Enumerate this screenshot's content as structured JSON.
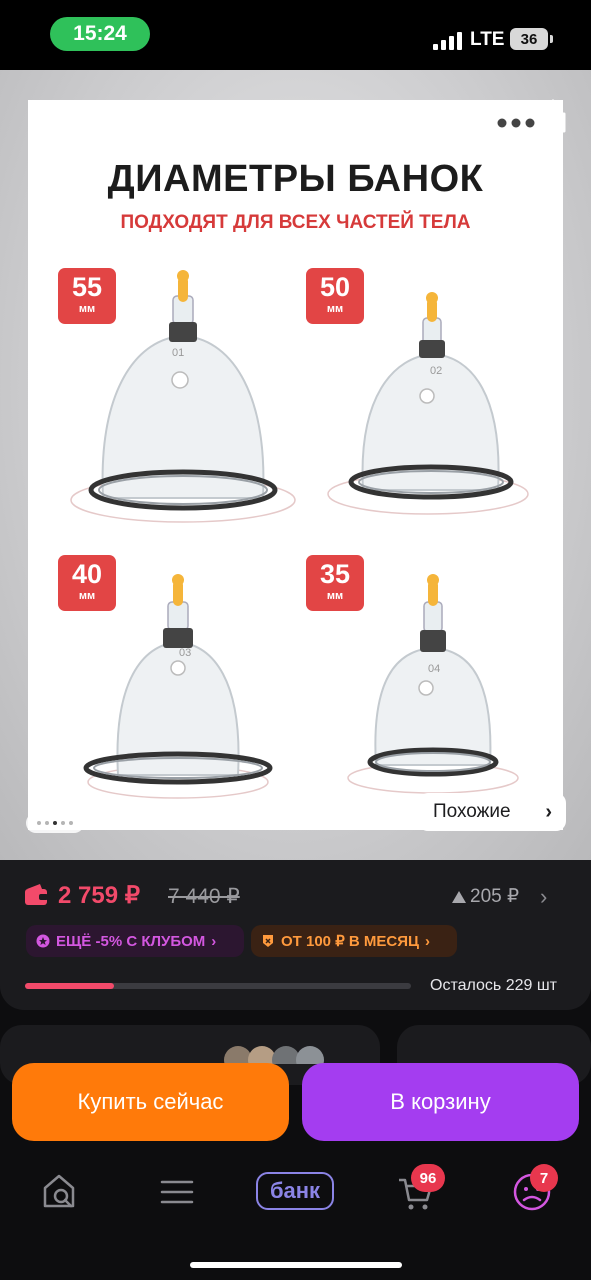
{
  "status_bar": {
    "time": "15:24",
    "network": "LTE",
    "battery": "36"
  },
  "product_image": {
    "title": "ДИАМЕТРЫ БАНОК",
    "subtitle": "ПОДХОДЯТ ДЛЯ ВСЕХ ЧАСТЕЙ ТЕЛА",
    "sizes": [
      {
        "value": "55",
        "unit": "мм",
        "cup_label": "01"
      },
      {
        "value": "50",
        "unit": "мм",
        "cup_label": "02"
      },
      {
        "value": "40",
        "unit": "мм",
        "cup_label": "03"
      },
      {
        "value": "35",
        "unit": "мм",
        "cup_label": "04"
      }
    ],
    "similar_label": "Похожие",
    "carousel_active_index": 3,
    "carousel_count": 5
  },
  "price": {
    "current": "2 759 ₽",
    "old": "7 440 ₽",
    "delta": "205 ₽",
    "club_offer": "ЕЩЁ -5% С КЛУБОМ",
    "installment": "ОТ 100 ₽ В МЕСЯЦ",
    "remaining_label": "Осталось 229 шт",
    "stock_level_fraction": 0.23
  },
  "actions": {
    "buy_now": "Купить сейчас",
    "add_to_cart": "В корзину"
  },
  "bottom_nav": {
    "bank_label": "банк",
    "cart_badge": "96",
    "profile_badge": "7"
  },
  "colors": {
    "price": "#f24a6a",
    "buy_button": "#ff7a0a",
    "cart_button": "#a43df0",
    "club_chip_text": "#d357e0",
    "installment_chip_text": "#ff9a3d",
    "badge": "#e8374e"
  },
  "icons": [
    "back-icon",
    "heart-icon",
    "more-icon",
    "share-icon",
    "wallet-icon",
    "arrow-up-icon",
    "home-search-icon",
    "menu-icon",
    "bank-icon",
    "cart-icon",
    "profile-icon"
  ]
}
